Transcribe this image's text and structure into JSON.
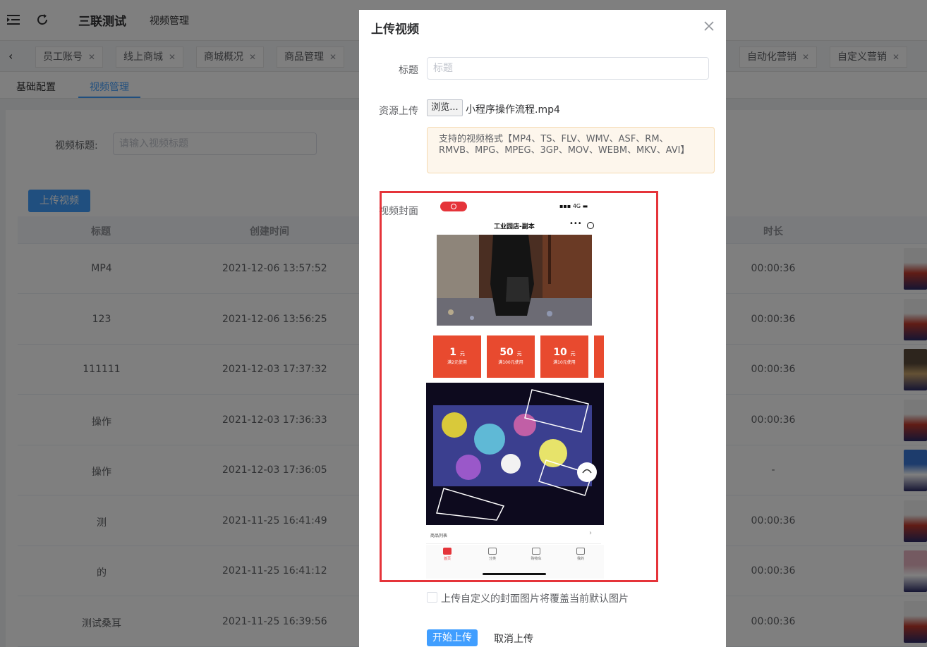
{
  "app": {
    "brand": "三联测试",
    "page_name": "视频管理"
  },
  "tabs": [
    {
      "label": "员工账号"
    },
    {
      "label": "线上商城"
    },
    {
      "label": "商城概况"
    },
    {
      "label": "商品管理"
    },
    {
      "label": "自动化营销"
    },
    {
      "label": "自定义营销"
    }
  ],
  "subnav": {
    "basic": "基础配置",
    "video": "视频管理"
  },
  "filter": {
    "label": "视频标题:",
    "placeholder": "请输入视频标题"
  },
  "upload_button": "上传视频",
  "table": {
    "headers": {
      "title": "标题",
      "created": "创建时间",
      "duration": "时长"
    },
    "rows": [
      {
        "title": "MP4",
        "created": "2021-12-06 13:57:52",
        "duration": "00:00:36"
      },
      {
        "title": "123",
        "created": "2021-12-06 13:56:25",
        "duration": "00:00:36"
      },
      {
        "title": "111111",
        "created": "2021-12-03 17:37:32",
        "duration": "00:00:36"
      },
      {
        "title": "操作",
        "created": "2021-12-03 17:36:33",
        "duration": "00:00:36"
      },
      {
        "title": "操作",
        "created": "2021-12-03 17:36:05",
        "duration": "-"
      },
      {
        "title": "测",
        "created": "2021-11-25 16:41:49",
        "duration": "00:00:36"
      },
      {
        "title": "的",
        "created": "2021-11-25 16:41:12",
        "duration": "00:00:36"
      },
      {
        "title": "测试桑耳",
        "created": "2021-11-25 16:39:56",
        "duration": "00:00:36"
      }
    ]
  },
  "dialog": {
    "title": "上传视频",
    "title_label": "标题",
    "title_placeholder": "标题",
    "source_label": "资源上传",
    "browse": "浏览...",
    "file_name": "小程序操作流程.mp4",
    "formats_notice": "支持的视频格式【MP4、TS、FLV、WMV、ASF、RM、RMVB、MPG、MPEG、3GP、MOV、WEBM、MKV、AVI】",
    "cover_label": "视频封面",
    "checkbox_label": "上传自定义的封面图片将覆盖当前默认图片",
    "start": "开始上传",
    "cancel": "取消上传"
  },
  "phone": {
    "network": "4G",
    "shop_title": "工业园店-副本",
    "coupons": [
      {
        "amount": "1",
        "unit": "元",
        "condition": "满2元使用"
      },
      {
        "amount": "50",
        "unit": "元",
        "condition": "满100元使用"
      },
      {
        "amount": "10",
        "unit": "元",
        "condition": "满10元使用"
      }
    ],
    "list_label": "商品列表",
    "tabbar": [
      "首页",
      "分类",
      "购物车",
      "我的"
    ]
  },
  "colors": {
    "primary": "#409eff",
    "highlight_frame": "#e5343a",
    "overlay": "rgba(0,0,0,0.5)"
  }
}
